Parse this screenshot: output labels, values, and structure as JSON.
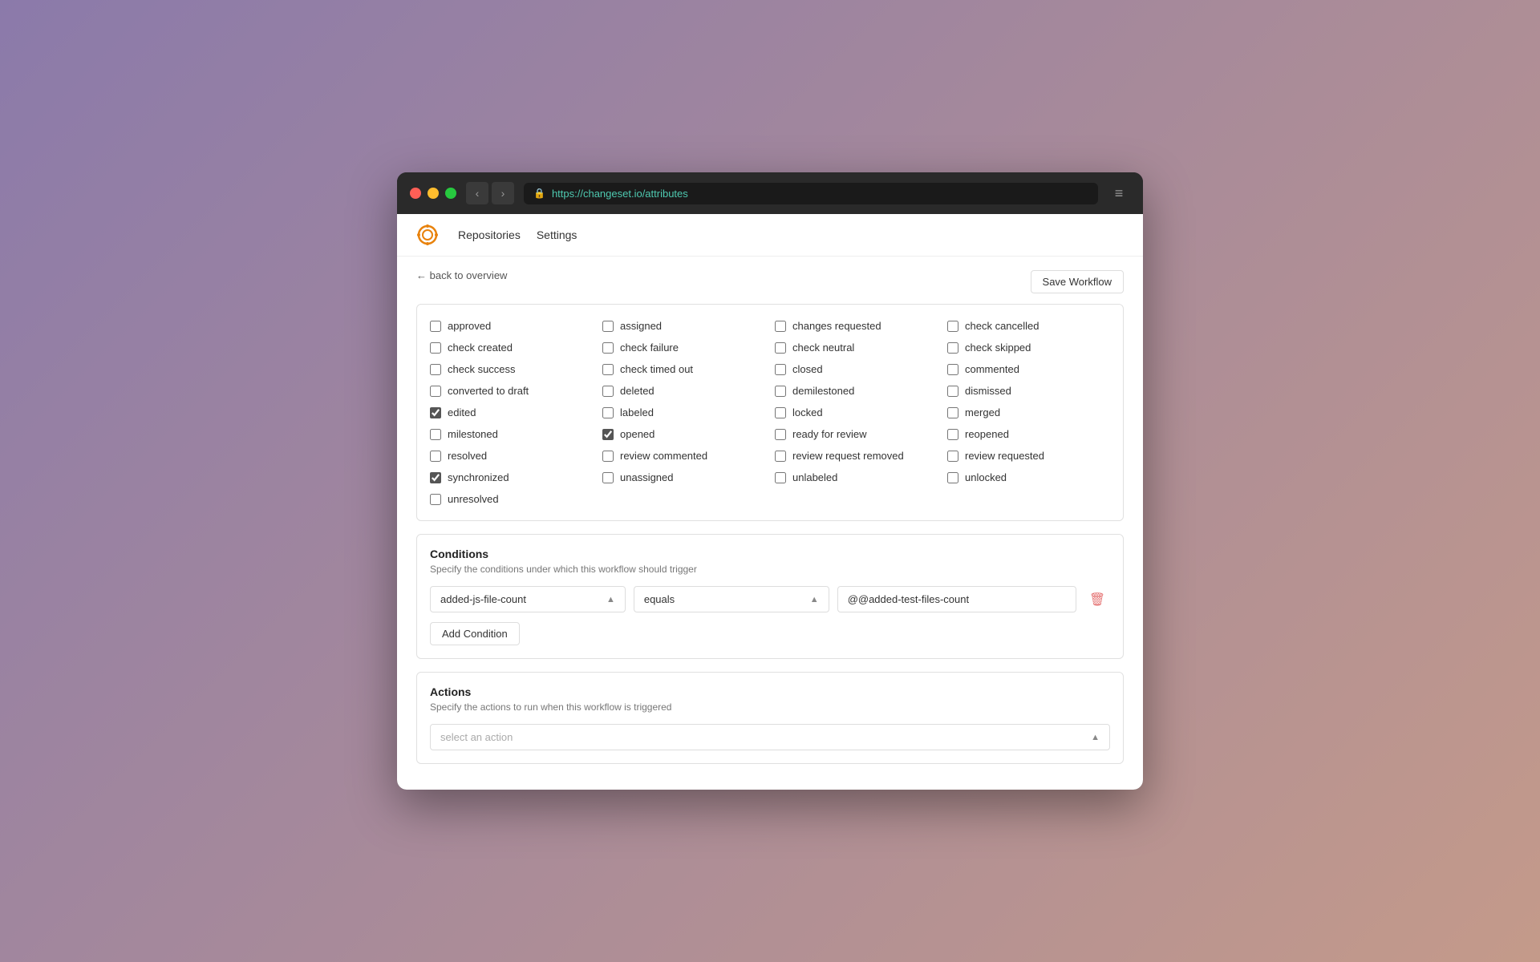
{
  "browser": {
    "url": "https://changeset.io/attributes",
    "url_scheme": "https://",
    "url_host": "changeset.io/attributes",
    "back_label": "‹",
    "forward_label": "›",
    "menu_label": "≡"
  },
  "nav": {
    "repositories_label": "Repositories",
    "settings_label": "Settings"
  },
  "page": {
    "back_label": "← back to overview",
    "save_button_label": "Save Workflow"
  },
  "checkboxes": {
    "items": [
      {
        "label": "approved",
        "checked": false,
        "col": 0
      },
      {
        "label": "assigned",
        "checked": false,
        "col": 1
      },
      {
        "label": "changes requested",
        "checked": false,
        "col": 2
      },
      {
        "label": "check cancelled",
        "checked": false,
        "col": 3
      },
      {
        "label": "check created",
        "checked": false,
        "col": 0
      },
      {
        "label": "check failure",
        "checked": false,
        "col": 1
      },
      {
        "label": "check neutral",
        "checked": false,
        "col": 2
      },
      {
        "label": "check skipped",
        "checked": false,
        "col": 3
      },
      {
        "label": "check success",
        "checked": false,
        "col": 0
      },
      {
        "label": "check timed out",
        "checked": false,
        "col": 1
      },
      {
        "label": "closed",
        "checked": false,
        "col": 2
      },
      {
        "label": "commented",
        "checked": false,
        "col": 3
      },
      {
        "label": "converted to draft",
        "checked": false,
        "col": 0
      },
      {
        "label": "deleted",
        "checked": false,
        "col": 1
      },
      {
        "label": "demilestoned",
        "checked": false,
        "col": 2
      },
      {
        "label": "dismissed",
        "checked": false,
        "col": 3
      },
      {
        "label": "edited",
        "checked": true,
        "col": 0
      },
      {
        "label": "labeled",
        "checked": false,
        "col": 1
      },
      {
        "label": "locked",
        "checked": false,
        "col": 2
      },
      {
        "label": "merged",
        "checked": false,
        "col": 3
      },
      {
        "label": "milestoned",
        "checked": false,
        "col": 0
      },
      {
        "label": "opened",
        "checked": true,
        "col": 1
      },
      {
        "label": "ready for review",
        "checked": false,
        "col": 2
      },
      {
        "label": "reopened",
        "checked": false,
        "col": 3
      },
      {
        "label": "resolved",
        "checked": false,
        "col": 0
      },
      {
        "label": "review commented",
        "checked": false,
        "col": 1
      },
      {
        "label": "review request removed",
        "checked": false,
        "col": 2
      },
      {
        "label": "review requested",
        "checked": false,
        "col": 3
      },
      {
        "label": "synchronized",
        "checked": true,
        "col": 0
      },
      {
        "label": "unassigned",
        "checked": false,
        "col": 1
      },
      {
        "label": "unlabeled",
        "checked": false,
        "col": 2
      },
      {
        "label": "unlocked",
        "checked": false,
        "col": 3
      },
      {
        "label": "unresolved",
        "checked": false,
        "col": 0
      }
    ]
  },
  "conditions": {
    "title": "Conditions",
    "subtitle": "Specify the conditions under which this workflow should trigger",
    "field_label": "added-js-file-count",
    "operator_label": "equals",
    "value_label": "@@added-test-files-count",
    "add_button_label": "Add Condition"
  },
  "actions": {
    "title": "Actions",
    "subtitle": "Specify the actions to run when this workflow is triggered",
    "placeholder": "select an action"
  }
}
